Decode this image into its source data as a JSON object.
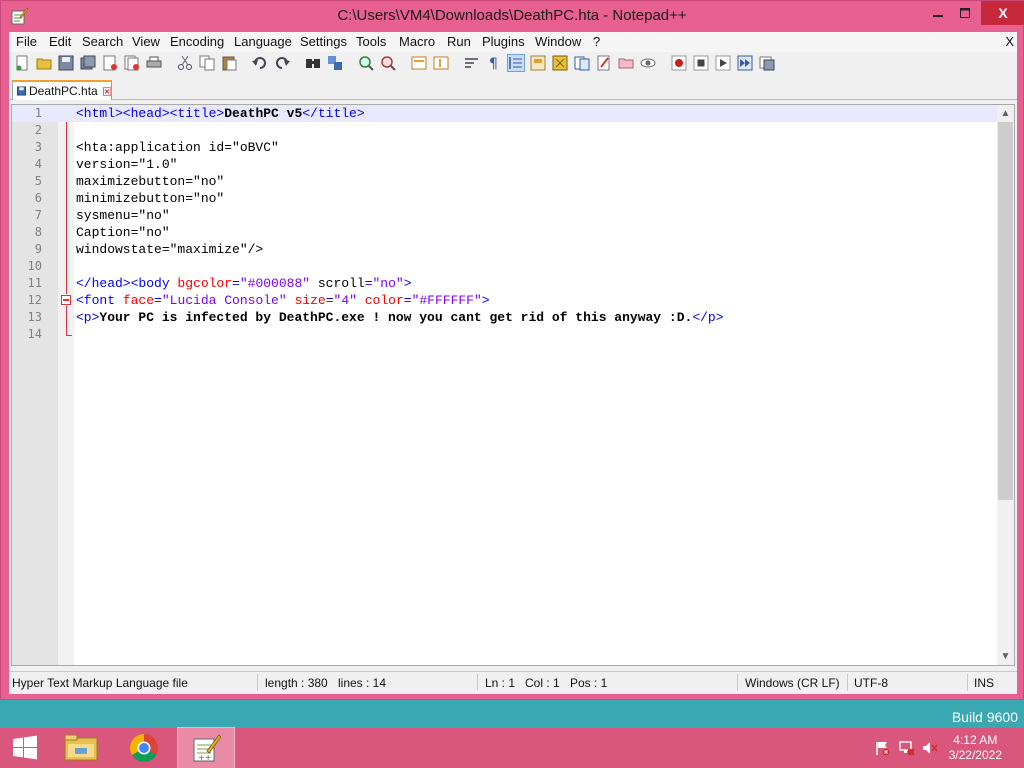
{
  "window": {
    "title": "C:\\Users\\VM4\\Downloads\\DeathPC.hta - Notepad++",
    "close_label": "X"
  },
  "menu": {
    "items": [
      "File",
      "Edit",
      "Search",
      "View",
      "Encoding",
      "Language",
      "Settings",
      "Tools",
      "Macro",
      "Run",
      "Plugins",
      "Window",
      "?"
    ],
    "close_doc": "X"
  },
  "tab": {
    "label": "DeathPC.hta"
  },
  "editor": {
    "line_numbers": [
      "1",
      "2",
      "3",
      "4",
      "5",
      "6",
      "7",
      "8",
      "9",
      "10",
      "11",
      "12",
      "13",
      "14"
    ],
    "lines": [
      [
        [
          "tag",
          "<html><head><title>"
        ],
        [
          "txt",
          "DeathPC v5"
        ],
        [
          "tag",
          "</title>"
        ]
      ],
      [],
      [
        [
          "plain",
          "<hta:application id=\"oBVC\""
        ]
      ],
      [
        [
          "plain",
          "version=\"1.0\""
        ]
      ],
      [
        [
          "plain",
          "maximizebutton=\"no\""
        ]
      ],
      [
        [
          "plain",
          "minimizebutton=\"no\""
        ]
      ],
      [
        [
          "plain",
          "sysmenu=\"no\""
        ]
      ],
      [
        [
          "plain",
          "Caption=\"no\""
        ]
      ],
      [
        [
          "plain",
          "windowstate=\"maximize\"/>"
        ]
      ],
      [],
      [
        [
          "tag",
          "</head><body "
        ],
        [
          "attr",
          "bgcolor"
        ],
        [
          "tag",
          "="
        ],
        [
          "val",
          "\"#000088\""
        ],
        [
          "tag",
          " "
        ],
        [
          "plain",
          "scroll"
        ],
        [
          "tag",
          "="
        ],
        [
          "val",
          "\"no\""
        ],
        [
          "tag",
          ">"
        ]
      ],
      [
        [
          "tag",
          "<font "
        ],
        [
          "attr",
          "face"
        ],
        [
          "tag",
          "="
        ],
        [
          "val",
          "\"Lucida Console\""
        ],
        [
          "tag",
          " "
        ],
        [
          "attr",
          "size"
        ],
        [
          "tag",
          "="
        ],
        [
          "val",
          "\"4\""
        ],
        [
          "tag",
          " "
        ],
        [
          "attr",
          "color"
        ],
        [
          "tag",
          "="
        ],
        [
          "val",
          "\"#FFFFFF\""
        ],
        [
          "tag",
          ">"
        ]
      ],
      [
        [
          "tag",
          "<p>"
        ],
        [
          "txt",
          "Your PC is infected by DeathPC.exe ! now you cant get rid of this anyway :D."
        ],
        [
          "tag",
          "</p>"
        ]
      ],
      []
    ]
  },
  "statusbar": {
    "file_type": "Hyper Text Markup Language file",
    "length": "length : 380",
    "lines": "lines : 14",
    "ln": "Ln : 1",
    "col": "Col : 1",
    "pos": "Pos : 1",
    "eol": "Windows (CR LF)",
    "encoding": "UTF-8",
    "mode": "INS"
  },
  "desktop": {
    "build": "Build 9600"
  },
  "taskbar": {
    "time": "4:12 AM",
    "date": "3/22/2022"
  },
  "colors": {
    "accent": "#e8608f",
    "taskbar": "#d9567d",
    "tag": "#0000ff",
    "attr": "#ff0000",
    "value": "#8000ff"
  }
}
